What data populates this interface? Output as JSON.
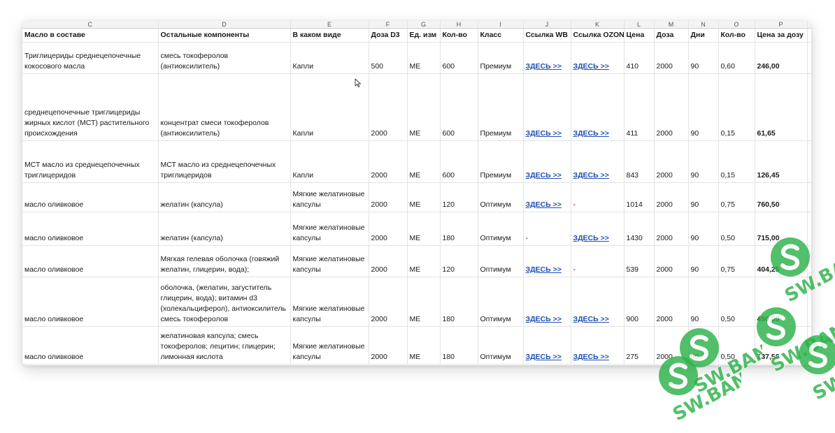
{
  "columns": [
    "C",
    "D",
    "E",
    "F",
    "G",
    "H",
    "I",
    "J",
    "K",
    "L",
    "M",
    "N",
    "O",
    "P",
    ""
  ],
  "headers": [
    "Масло в составе",
    "Остальные компоненты",
    "В каком виде",
    "Доза D3",
    "Ед. изм",
    "Кол-во",
    "Класс",
    "Ссылка WB",
    "Ссылка OZON",
    "Цена",
    "Доза",
    "Дни",
    "Кол-во",
    "Цена за дозу",
    ""
  ],
  "rows": [
    {
      "oil": "Триглицериды среднецепочечные кокосового масла",
      "other": "смесь токоферолов (антиоксилитель)",
      "form": "Капли",
      "d3": "500",
      "unit": "МЕ",
      "qty": "600",
      "cls": "Премиум",
      "wb": "ЗДЕСЬ >>",
      "ozon": "ЗДЕСЬ >>",
      "price": "410",
      "dose": "2000",
      "days": "90",
      "qty2": "0,60",
      "ppd": "246,00"
    },
    {
      "oil": "среднецепочечные триглицериды жирных кислот (МСТ) растительного происхождения",
      "other": "концентрат смеси токоферолов (антиоксилитель)",
      "form": "Капли",
      "d3": "2000",
      "unit": "МЕ",
      "qty": "600",
      "cls": "Премиум",
      "wb": "ЗДЕСЬ >>",
      "ozon": "ЗДЕСЬ >>",
      "price": "411",
      "dose": "2000",
      "days": "90",
      "qty2": "0,15",
      "ppd": "61,65"
    },
    {
      "oil": "МСТ масло из среднецепочечных триглицеридов",
      "other": "МСТ масло из среднецепочечных триглицеридов",
      "form": "Капли",
      "d3": "2000",
      "unit": "МЕ",
      "qty": "600",
      "cls": "Премиум",
      "wb": "ЗДЕСЬ >>",
      "ozon": "ЗДЕСЬ >>",
      "price": "843",
      "dose": "2000",
      "days": "90",
      "qty2": "0,15",
      "ppd": "126,45"
    },
    {
      "oil": "масло оливковое",
      "other": "желатин (капсула)",
      "form": "Мягкие желатиновые капсулы",
      "d3": "2000",
      "unit": "МЕ",
      "qty": "120",
      "cls": "Оптимум",
      "wb": "ЗДЕСЬ >>",
      "ozon": "-",
      "price": "1014",
      "dose": "2000",
      "days": "90",
      "qty2": "0,75",
      "ppd": "760,50"
    },
    {
      "oil": "масло оливковое",
      "other": "желатин (капсула)",
      "form": "Мягкие желатиновые капсулы",
      "d3": "2000",
      "unit": "МЕ",
      "qty": "180",
      "cls": "Оптимум",
      "wb": "-",
      "ozon": "ЗДЕСЬ >>",
      "price": "1430",
      "dose": "2000",
      "days": "90",
      "qty2": "0,50",
      "ppd": "715,00"
    },
    {
      "oil": "масло оливковое",
      "other": "Мягкая гелевая оболочка (говяжий желатин, глицерин, вода);",
      "form": "Мягкие желатиновые капсулы",
      "d3": "2000",
      "unit": "МЕ",
      "qty": "120",
      "cls": "Оптимум",
      "wb": "ЗДЕСЬ >>",
      "ozon": "-",
      "price": "539",
      "dose": "2000",
      "days": "90",
      "qty2": "0,75",
      "ppd": "404,25"
    },
    {
      "oil": "масло оливковое",
      "other": "оболочка, (желатин, загуститель глицерин, вода); витамин d3 (холекальциферол), антиоксилитель смесь токоферолов",
      "form": "Мягкие желатиновые капсулы",
      "d3": "2000",
      "unit": "МЕ",
      "qty": "180",
      "cls": "Оптимум",
      "wb": "ЗДЕСЬ >>",
      "ozon": "ЗДЕСЬ >>",
      "price": "900",
      "dose": "2000",
      "days": "90",
      "qty2": "0,50",
      "ppd": "450,00"
    },
    {
      "oil": "масло оливковое",
      "other": "желатиновая капсула; смесь токоферолов; лецитин; глицерин; лимонная кислота",
      "form": "Мягкие желатиновые капсулы",
      "d3": "2000",
      "unit": "МЕ",
      "qty": "180",
      "cls": "Оптимум",
      "wb": "ЗДЕСЬ >>",
      "ozon": "ЗДЕСЬ >>",
      "price": "275",
      "dose": "2000",
      "days": "90",
      "qty2": "0,50",
      "ppd": "137,50"
    }
  ],
  "watermark": {
    "text": "SW.BAND",
    "color": "#2db24a"
  },
  "colors": {
    "link": "#1f4fb5",
    "price": "#d0312d",
    "per_dose": "#23a552"
  }
}
